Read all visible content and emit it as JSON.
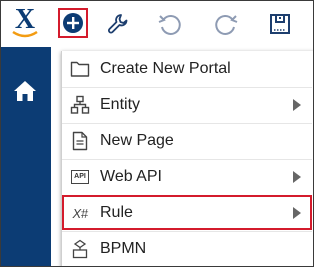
{
  "colors": {
    "nav_bg": "#0c3c74",
    "accent_red": "#d41b2c",
    "icon_gray": "#7a8ba8",
    "add_button_blue": "#0c3c74",
    "logo_orange": "#f39c12"
  },
  "toolbar": {
    "logo_text": "X",
    "icons": [
      "plus-circle-icon",
      "wrench-icon",
      "undo-icon",
      "redo-icon",
      "save-icon"
    ]
  },
  "leftnav": {
    "icons": [
      "home-icon"
    ]
  },
  "menu": {
    "items": [
      {
        "label": "Create New Portal",
        "icon": "folder-icon",
        "has_submenu": false
      },
      {
        "label": "Entity",
        "icon": "entity-hierarchy-icon",
        "has_submenu": true
      },
      {
        "label": "New Page",
        "icon": "page-icon",
        "has_submenu": false
      },
      {
        "label": "Web API",
        "icon": "api-icon",
        "icon_text": "API",
        "has_submenu": true
      },
      {
        "label": "Rule",
        "icon": "rule-icon",
        "icon_text": "X#",
        "has_submenu": true,
        "highlighted": true
      },
      {
        "label": "BPMN",
        "icon": "bpmn-icon",
        "has_submenu": false
      }
    ]
  }
}
